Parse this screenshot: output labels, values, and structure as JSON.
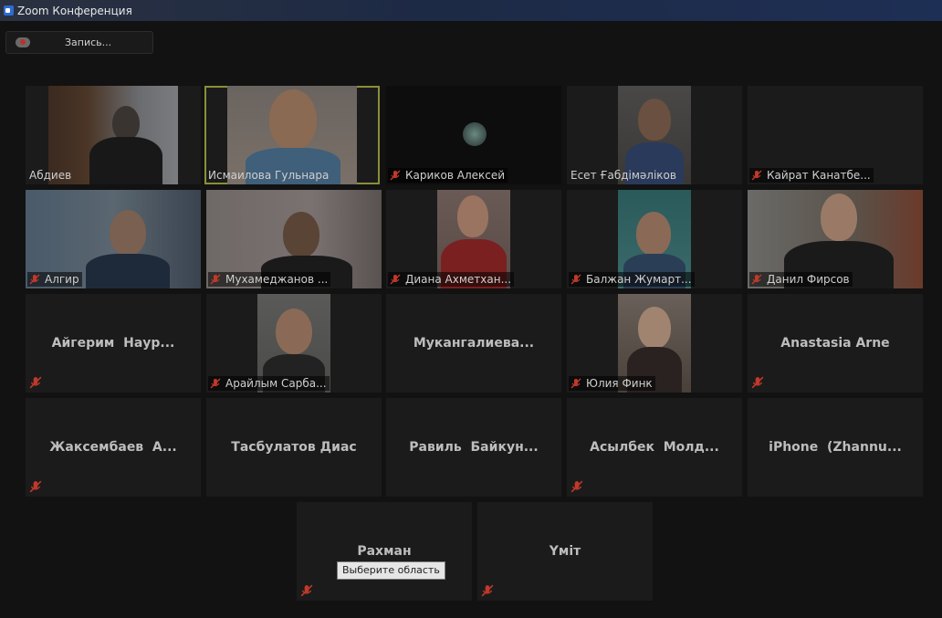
{
  "window": {
    "title": "Zoom Конференция"
  },
  "toolbar": {
    "record_label": "Запись..."
  },
  "participants": {
    "abdiev": "Абдиев",
    "ismailova": "Исмаилова Гульнара",
    "karikov": "Кариков Алексей",
    "eset": "Есет Ғабдімәліков",
    "kairat": "Кайрат Канатбе...",
    "algir": "Алгир",
    "mukhamedzhanov": "Мухамеджанов ...",
    "diana": "Диана Ахметхан...",
    "balzhan": "Балжан Жумарт...",
    "danil": "Данил Фирсов",
    "aigerim": "Айгерим  Наур...",
    "araylym": "Арайлым Сарба...",
    "mukangalieva": "Мукангалиева...",
    "yuliya": "Юлия Финк",
    "anastasia": "Anastasia Arne",
    "zhaksembaev": "Жаксембаев  А...",
    "tasbulatov": "Тасбулатов Диас",
    "ravil": "Равиль  Байкун...",
    "asylbek": "Асылбек  Молд...",
    "iphone": "iPhone  (Zhannu...",
    "rakhman": "Рахман",
    "umit": "Үміт"
  },
  "tooltip": {
    "text": "Выберите область"
  },
  "colors": {
    "active_speaker_border": "#8a8f3a",
    "muted_mic": "#c0392b",
    "background": "#121212"
  }
}
